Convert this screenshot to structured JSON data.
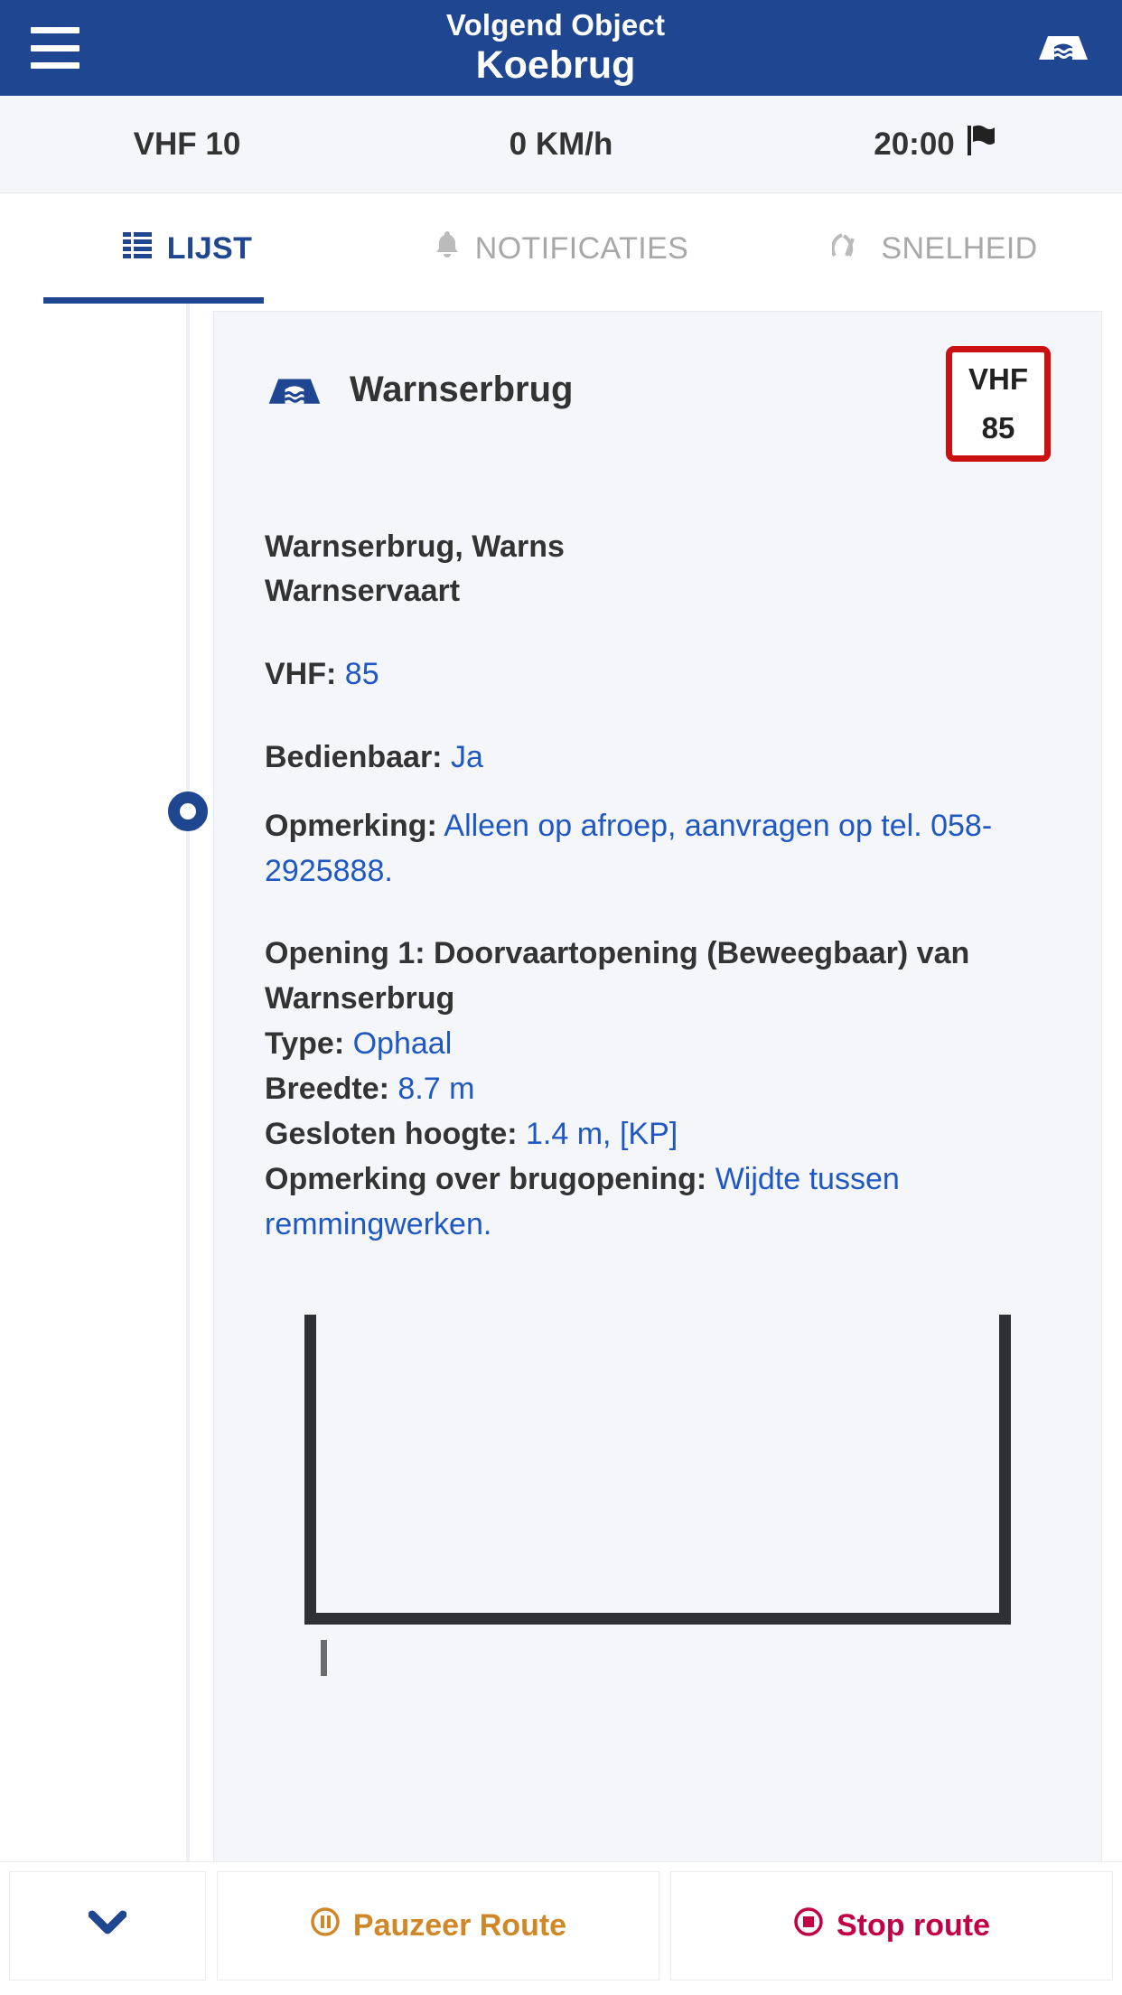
{
  "appbar": {
    "menu_icon": "hamburger-icon",
    "subtitle": "Volgend Object",
    "title": "Koebrug",
    "right_icon": "bridge-icon"
  },
  "infobar": {
    "vhf": "VHF 10",
    "speed": "0 KM/h",
    "eta": "20:00",
    "flag_icon": "flag-icon"
  },
  "tabs": [
    {
      "label": "LIJST",
      "icon": "list-icon",
      "active": true
    },
    {
      "label": "NOTIFICATIES",
      "icon": "bell-icon",
      "active": false
    },
    {
      "label": "SNELHEID",
      "icon": "speedometer-icon",
      "active": false
    }
  ],
  "card": {
    "icon": "bridge-icon",
    "title": "Warnserbrug",
    "badge": {
      "label": "VHF",
      "value": "85"
    },
    "address_line1": "Warnserbrug, Warns",
    "address_line2": "Warnservaart",
    "details": [
      {
        "key": "VHF:",
        "value": "85"
      },
      {
        "key": "Bedienbaar:",
        "value": "Ja"
      },
      {
        "key": "Opmerking:",
        "value": "Alleen op afroep, aanvragen op tel. 058-2925888."
      }
    ],
    "opening": {
      "heading": "Opening 1: Doorvaartopening (Beweegbaar) van Warnserbrug",
      "rows": [
        {
          "key": "Type:",
          "value": "Ophaal"
        },
        {
          "key": "Breedte:",
          "value": "8.7 m"
        },
        {
          "key": "Gesloten hoogte:",
          "value": "1.4 m, [KP]"
        },
        {
          "key": "Opmerking over brugopening:",
          "value": "Wijdte tussen remmingwerken."
        }
      ]
    },
    "diagram_name": "bridge-opening-diagram"
  },
  "actionbar": {
    "collapse_icon": "chevron-down-icon",
    "pause_icon": "pause-circle-icon",
    "pause_label": "Pauzeer Route",
    "stop_icon": "stop-circle-icon",
    "stop_label": "Stop route"
  },
  "colors": {
    "brand": "#1f4690",
    "link": "#1f57c3",
    "badge_border": "#cc1111",
    "pause": "#d08728",
    "stop": "#c30045",
    "panel": "#f4f6fa"
  }
}
